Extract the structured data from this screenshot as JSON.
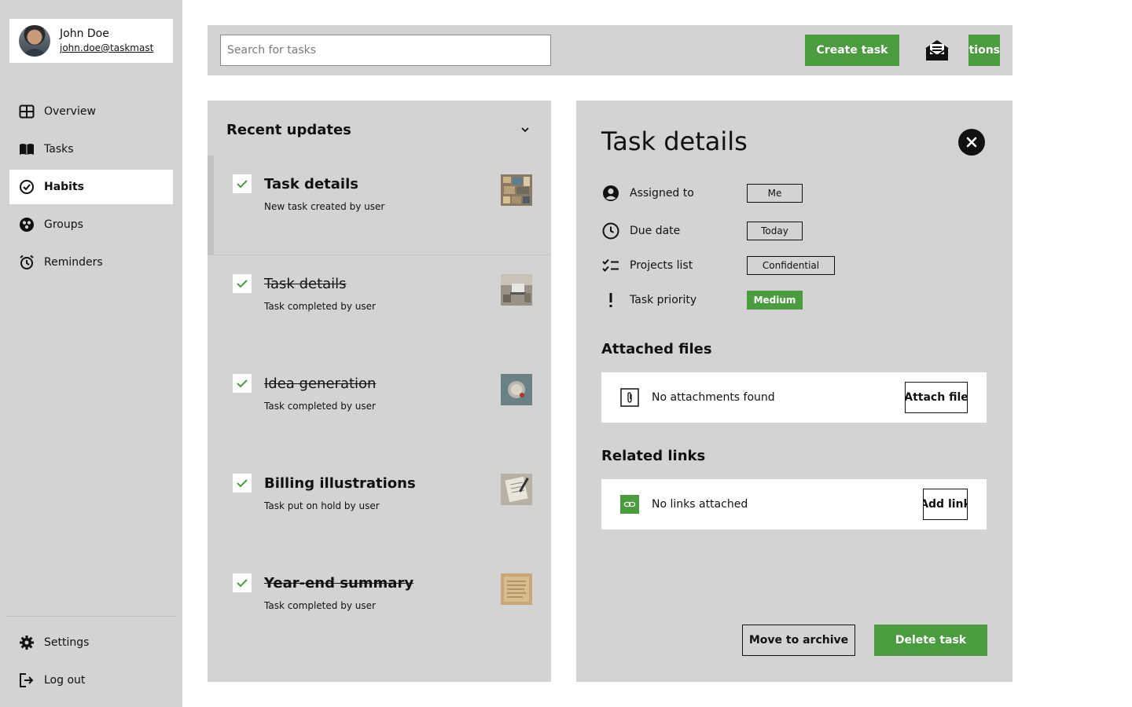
{
  "user": {
    "name": "John Doe",
    "email": "john.doe@taskmast"
  },
  "nav": {
    "items": [
      {
        "label": "Overview",
        "icon": "overview-icon"
      },
      {
        "label": "Tasks",
        "icon": "book-icon"
      },
      {
        "label": "Habits",
        "icon": "check-circle-icon",
        "active": true
      },
      {
        "label": "Groups",
        "icon": "groups-icon"
      },
      {
        "label": "Reminders",
        "icon": "alarm-icon"
      }
    ],
    "bottom": [
      {
        "label": "Settings",
        "icon": "gear-icon"
      },
      {
        "label": "Log out",
        "icon": "logout-icon"
      }
    ]
  },
  "topbar": {
    "search_placeholder": "Search for tasks",
    "create_label": "Create task",
    "options_label": "Options"
  },
  "updates": {
    "title": "Recent updates",
    "items": [
      {
        "title": "Task details",
        "subtitle": "New task created by user",
        "struck": false
      },
      {
        "title": "Task details",
        "subtitle": "Task completed by user",
        "struck": true
      },
      {
        "title": "Idea generation",
        "subtitle": "Task completed by user",
        "struck": true
      },
      {
        "title": "Billing illustrations",
        "subtitle": "Task put on hold by user",
        "struck": false
      },
      {
        "title": "Year-end summary",
        "subtitle": "Task completed by user",
        "struck": true
      }
    ]
  },
  "details": {
    "title": "Task details",
    "properties": [
      {
        "label": "Assigned to",
        "value": "Me",
        "icon": "user-circle-icon"
      },
      {
        "label": "Due date",
        "value": "Today",
        "icon": "clock-icon"
      },
      {
        "label": "Projects list",
        "value": "Confidential",
        "icon": "checklist-icon"
      },
      {
        "label": "Task priority",
        "value": "Medium",
        "icon": "exclamation-icon"
      }
    ],
    "attached_files_title": "Attached files",
    "attachments_empty": "No attachments found",
    "attach_label": "Attach file",
    "related_links_title": "Related links",
    "links_empty": "No links attached",
    "add_link_label": "Add link",
    "archive_label": "Move to archive",
    "delete_label": "Delete task"
  },
  "colors": {
    "accent": "#4a9c3f",
    "panel": "#d3d3d3",
    "sidebar": "#d3d3d3"
  }
}
